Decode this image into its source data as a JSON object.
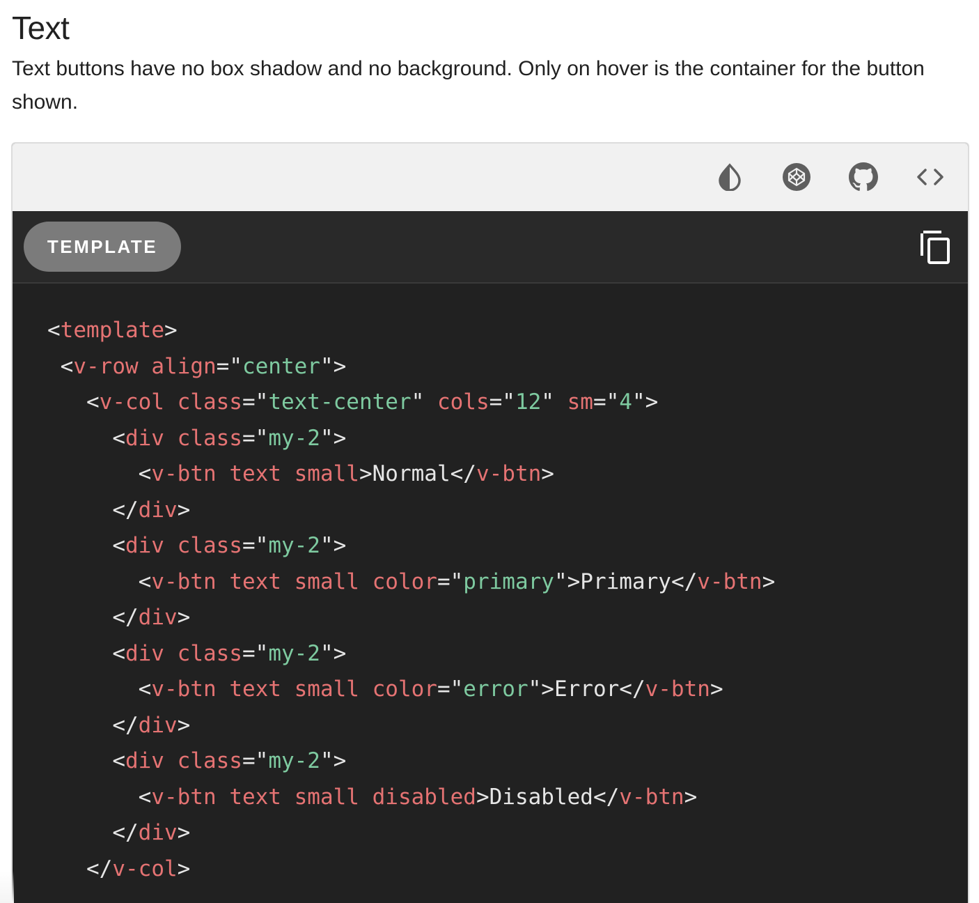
{
  "section": {
    "title": "Text",
    "description": "Text buttons have no box shadow and no background. Only on hover is the container for the button shown."
  },
  "toolbar": {
    "buttons": [
      {
        "name": "invert-example-colors-icon",
        "icon": "opacity-drop-icon"
      },
      {
        "name": "codepen-icon",
        "icon": "codepen-icon"
      },
      {
        "name": "github-icon",
        "icon": "github-icon"
      },
      {
        "name": "view-source-icon",
        "icon": "code-brackets-icon"
      }
    ]
  },
  "editor": {
    "tab_label": "TEMPLATE",
    "copy_icon": "content-copy-icon"
  },
  "colors": {
    "toolbar_bg": "#f1f1f1",
    "editor_bg": "#212121",
    "tag": "#e57373",
    "string": "#7ecaa0",
    "text": "#e6e6e6",
    "tab_bg": "#7b7b7b"
  },
  "code_lines": [
    [
      {
        "t": "punc",
        "v": "<"
      },
      {
        "t": "tag",
        "v": "template"
      },
      {
        "t": "punc",
        "v": ">"
      }
    ],
    [
      {
        "t": "punc",
        "v": " <"
      },
      {
        "t": "tag",
        "v": "v-row"
      },
      {
        "t": "text",
        "v": " "
      },
      {
        "t": "attr",
        "v": "align"
      },
      {
        "t": "punc",
        "v": "=\""
      },
      {
        "t": "str",
        "v": "center"
      },
      {
        "t": "punc",
        "v": "\">"
      }
    ],
    [
      {
        "t": "punc",
        "v": "   <"
      },
      {
        "t": "tag",
        "v": "v-col"
      },
      {
        "t": "text",
        "v": " "
      },
      {
        "t": "attr",
        "v": "class"
      },
      {
        "t": "punc",
        "v": "=\""
      },
      {
        "t": "str",
        "v": "text-center"
      },
      {
        "t": "punc",
        "v": "\""
      },
      {
        "t": "text",
        "v": " "
      },
      {
        "t": "attr",
        "v": "cols"
      },
      {
        "t": "punc",
        "v": "=\""
      },
      {
        "t": "str",
        "v": "12"
      },
      {
        "t": "punc",
        "v": "\""
      },
      {
        "t": "text",
        "v": " "
      },
      {
        "t": "attr",
        "v": "sm"
      },
      {
        "t": "punc",
        "v": "=\""
      },
      {
        "t": "str",
        "v": "4"
      },
      {
        "t": "punc",
        "v": "\">"
      }
    ],
    [
      {
        "t": "punc",
        "v": "     <"
      },
      {
        "t": "tag",
        "v": "div"
      },
      {
        "t": "text",
        "v": " "
      },
      {
        "t": "attr",
        "v": "class"
      },
      {
        "t": "punc",
        "v": "=\""
      },
      {
        "t": "str",
        "v": "my-2"
      },
      {
        "t": "punc",
        "v": "\">"
      }
    ],
    [
      {
        "t": "punc",
        "v": "       <"
      },
      {
        "t": "tag",
        "v": "v-btn"
      },
      {
        "t": "text",
        "v": " "
      },
      {
        "t": "attr",
        "v": "text"
      },
      {
        "t": "text",
        "v": " "
      },
      {
        "t": "attr",
        "v": "small"
      },
      {
        "t": "punc",
        "v": ">"
      },
      {
        "t": "text",
        "v": "Normal"
      },
      {
        "t": "punc",
        "v": "</"
      },
      {
        "t": "tag",
        "v": "v-btn"
      },
      {
        "t": "punc",
        "v": ">"
      }
    ],
    [
      {
        "t": "punc",
        "v": "     </"
      },
      {
        "t": "tag",
        "v": "div"
      },
      {
        "t": "punc",
        "v": ">"
      }
    ],
    [
      {
        "t": "punc",
        "v": "     <"
      },
      {
        "t": "tag",
        "v": "div"
      },
      {
        "t": "text",
        "v": " "
      },
      {
        "t": "attr",
        "v": "class"
      },
      {
        "t": "punc",
        "v": "=\""
      },
      {
        "t": "str",
        "v": "my-2"
      },
      {
        "t": "punc",
        "v": "\">"
      }
    ],
    [
      {
        "t": "punc",
        "v": "       <"
      },
      {
        "t": "tag",
        "v": "v-btn"
      },
      {
        "t": "text",
        "v": " "
      },
      {
        "t": "attr",
        "v": "text"
      },
      {
        "t": "text",
        "v": " "
      },
      {
        "t": "attr",
        "v": "small"
      },
      {
        "t": "text",
        "v": " "
      },
      {
        "t": "attr",
        "v": "color"
      },
      {
        "t": "punc",
        "v": "=\""
      },
      {
        "t": "str",
        "v": "primary"
      },
      {
        "t": "punc",
        "v": "\">"
      },
      {
        "t": "text",
        "v": "Primary"
      },
      {
        "t": "punc",
        "v": "</"
      },
      {
        "t": "tag",
        "v": "v-btn"
      },
      {
        "t": "punc",
        "v": ">"
      }
    ],
    [
      {
        "t": "punc",
        "v": "     </"
      },
      {
        "t": "tag",
        "v": "div"
      },
      {
        "t": "punc",
        "v": ">"
      }
    ],
    [
      {
        "t": "punc",
        "v": "     <"
      },
      {
        "t": "tag",
        "v": "div"
      },
      {
        "t": "text",
        "v": " "
      },
      {
        "t": "attr",
        "v": "class"
      },
      {
        "t": "punc",
        "v": "=\""
      },
      {
        "t": "str",
        "v": "my-2"
      },
      {
        "t": "punc",
        "v": "\">"
      }
    ],
    [
      {
        "t": "punc",
        "v": "       <"
      },
      {
        "t": "tag",
        "v": "v-btn"
      },
      {
        "t": "text",
        "v": " "
      },
      {
        "t": "attr",
        "v": "text"
      },
      {
        "t": "text",
        "v": " "
      },
      {
        "t": "attr",
        "v": "small"
      },
      {
        "t": "text",
        "v": " "
      },
      {
        "t": "attr",
        "v": "color"
      },
      {
        "t": "punc",
        "v": "=\""
      },
      {
        "t": "str",
        "v": "error"
      },
      {
        "t": "punc",
        "v": "\">"
      },
      {
        "t": "text",
        "v": "Error"
      },
      {
        "t": "punc",
        "v": "</"
      },
      {
        "t": "tag",
        "v": "v-btn"
      },
      {
        "t": "punc",
        "v": ">"
      }
    ],
    [
      {
        "t": "punc",
        "v": "     </"
      },
      {
        "t": "tag",
        "v": "div"
      },
      {
        "t": "punc",
        "v": ">"
      }
    ],
    [
      {
        "t": "punc",
        "v": "     <"
      },
      {
        "t": "tag",
        "v": "div"
      },
      {
        "t": "text",
        "v": " "
      },
      {
        "t": "attr",
        "v": "class"
      },
      {
        "t": "punc",
        "v": "=\""
      },
      {
        "t": "str",
        "v": "my-2"
      },
      {
        "t": "punc",
        "v": "\">"
      }
    ],
    [
      {
        "t": "punc",
        "v": "       <"
      },
      {
        "t": "tag",
        "v": "v-btn"
      },
      {
        "t": "text",
        "v": " "
      },
      {
        "t": "attr",
        "v": "text"
      },
      {
        "t": "text",
        "v": " "
      },
      {
        "t": "attr",
        "v": "small"
      },
      {
        "t": "text",
        "v": " "
      },
      {
        "t": "attr",
        "v": "disabled"
      },
      {
        "t": "punc",
        "v": ">"
      },
      {
        "t": "text",
        "v": "Disabled"
      },
      {
        "t": "punc",
        "v": "</"
      },
      {
        "t": "tag",
        "v": "v-btn"
      },
      {
        "t": "punc",
        "v": ">"
      }
    ],
    [
      {
        "t": "punc",
        "v": "     </"
      },
      {
        "t": "tag",
        "v": "div"
      },
      {
        "t": "punc",
        "v": ">"
      }
    ],
    [
      {
        "t": "punc",
        "v": "   </"
      },
      {
        "t": "tag",
        "v": "v-col"
      },
      {
        "t": "punc",
        "v": ">"
      }
    ]
  ]
}
